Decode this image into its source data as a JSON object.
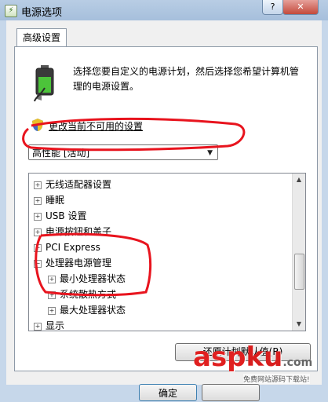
{
  "window": {
    "title": "电源选项",
    "help_glyph": "?",
    "close_glyph": "✕"
  },
  "tab": {
    "label": "高级设置"
  },
  "description": "选择您要自定义的电源计划，然后选择您希望计算机管理的电源设置。",
  "change_settings_link": "更改当前不可用的设置",
  "plan_select": {
    "value": "高性能 [活动]"
  },
  "tree": {
    "items": [
      {
        "label": "无线适配器设置",
        "expander": "+",
        "level": 0
      },
      {
        "label": "睡眠",
        "expander": "+",
        "level": 0
      },
      {
        "label": "USB 设置",
        "expander": "+",
        "level": 0
      },
      {
        "label": "电源按钮和盖子",
        "expander": "+",
        "level": 0
      },
      {
        "label": "PCI Express",
        "expander": "+",
        "level": 0
      },
      {
        "label": "处理器电源管理",
        "expander": "−",
        "level": 0
      },
      {
        "label": "最小处理器状态",
        "expander": "+",
        "level": 1
      },
      {
        "label": "系统散热方式",
        "expander": "+",
        "level": 1
      },
      {
        "label": "最大处理器状态",
        "expander": "+",
        "level": 1
      },
      {
        "label": "显示",
        "expander": "+",
        "level": 0
      }
    ]
  },
  "buttons": {
    "restore": "还原计划默认值(R)",
    "ok": "确定"
  },
  "watermark": {
    "text_a": "asp",
    "text_b": "ku",
    "suffix": ".com",
    "sub": "免费网站源码下载站!"
  },
  "colors": {
    "annotation_red": "#e8141e",
    "titlebar": "#b8cde4",
    "dialog_bg": "#f0f0f0"
  }
}
